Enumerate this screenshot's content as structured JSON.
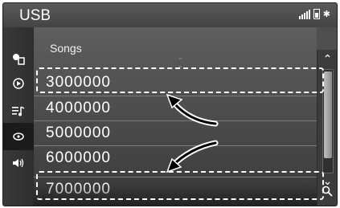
{
  "header": {
    "title": "USB"
  },
  "list": {
    "header": "Songs",
    "rows": [
      {
        "label": "3000000"
      },
      {
        "label": "4000000"
      },
      {
        "label": "5000000"
      },
      {
        "label": "6000000"
      },
      {
        "label": "7000000"
      }
    ]
  },
  "sidebar": {
    "items": [
      {
        "icon": "source-icon"
      },
      {
        "icon": "play-mode-icon"
      },
      {
        "icon": "music-list-icon"
      },
      {
        "icon": "eye-icon"
      },
      {
        "icon": "sound-icon"
      }
    ],
    "active_index": 3
  },
  "colors": {
    "screen_bg": "#4f4f4f",
    "annotation": "#ffffff"
  }
}
